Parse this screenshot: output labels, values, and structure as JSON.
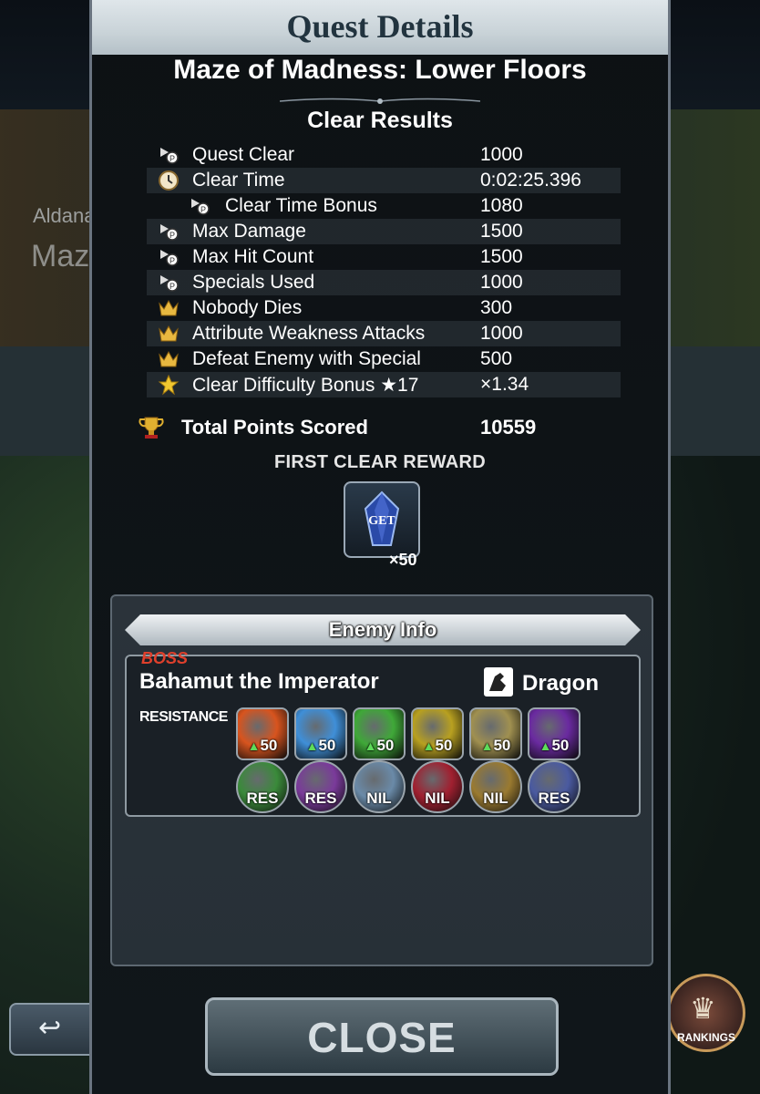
{
  "background": {
    "location": "Aldana",
    "quest_partial": "Maze of",
    "back_button_label": "B",
    "rankings_label": "RANKINGS"
  },
  "dialog": {
    "title": "Quest Details",
    "quest_name": "Maze of Madness: Lower Floors",
    "section_title": "Clear Results",
    "results": [
      {
        "icon": "points-icon",
        "label": "Quest Clear",
        "value": "1000",
        "sub": false
      },
      {
        "icon": "clock-icon",
        "label": "Clear Time",
        "value": "0:02:25.396",
        "sub": false
      },
      {
        "icon": "points-icon",
        "label": "Clear Time Bonus",
        "value": "1080",
        "sub": true
      },
      {
        "icon": "points-icon",
        "label": "Max Damage",
        "value": "1500",
        "sub": false
      },
      {
        "icon": "points-icon",
        "label": "Max Hit Count",
        "value": "1500",
        "sub": false
      },
      {
        "icon": "points-icon",
        "label": "Specials Used",
        "value": "1000",
        "sub": false
      },
      {
        "icon": "crown-icon",
        "label": "Nobody Dies",
        "value": "300",
        "sub": false
      },
      {
        "icon": "crown-icon",
        "label": "Attribute Weakness Attacks",
        "value": "1000",
        "sub": false
      },
      {
        "icon": "crown-icon",
        "label": "Defeat Enemy with Special",
        "value": "500",
        "sub": false
      },
      {
        "icon": "star-icon",
        "label": "Clear Difficulty Bonus ★17",
        "value": "×1.34",
        "sub": false
      }
    ],
    "total_label": "Total Points Scored",
    "total_value": "10559",
    "first_clear_label": "FIRST CLEAR REWARD",
    "reward_get": "GET",
    "reward_qty": "×50",
    "enemy_info_title": "Enemy Info",
    "boss_tag": "BOSS",
    "boss_name": "Bahamut the Imperator",
    "enemy_type": "Dragon",
    "resistance_label": "RESISTANCE",
    "resistances_row1": [
      {
        "element": "fire",
        "text": "50",
        "color": "#d8541e"
      },
      {
        "element": "ice",
        "text": "50",
        "color": "#3f8fd8"
      },
      {
        "element": "wind",
        "text": "50",
        "color": "#3fa838"
      },
      {
        "element": "lightning",
        "text": "50",
        "color": "#b8a020"
      },
      {
        "element": "holy",
        "text": "50",
        "color": "#a09050"
      },
      {
        "element": "dark",
        "text": "50",
        "color": "#6a2aa0"
      }
    ],
    "resistances_row2": [
      {
        "element": "earth",
        "text": "RES",
        "color": "#3a8a3a"
      },
      {
        "element": "poison",
        "text": "RES",
        "color": "#7a3a9a"
      },
      {
        "element": "water",
        "text": "NIL",
        "color": "#6a8aa8"
      },
      {
        "element": "bio",
        "text": "NIL",
        "color": "#a02030"
      },
      {
        "element": "bolt",
        "text": "NIL",
        "color": "#9a7a30"
      },
      {
        "element": "non-elemental",
        "text": "RES",
        "color": "#4a5aa0"
      }
    ],
    "close_label": "CLOSE"
  }
}
